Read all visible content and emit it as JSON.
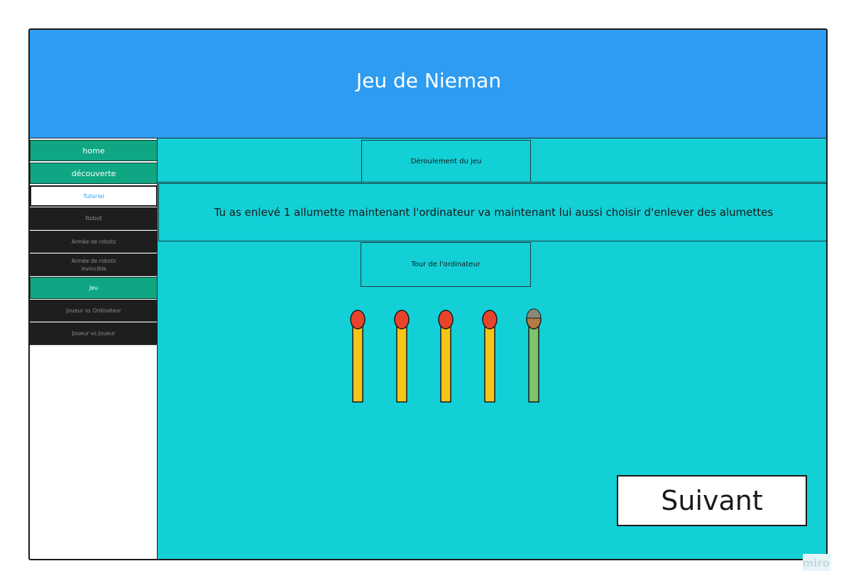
{
  "app": {
    "title": "Jeu de Nieman"
  },
  "sidebar": {
    "items": [
      {
        "label": "home"
      },
      {
        "label": "découverte"
      },
      {
        "label": "Tutoriel"
      },
      {
        "label": "Robot"
      },
      {
        "label": "Armée de robots"
      },
      {
        "label_line1": "Armée de robots",
        "label_line2": "invincible"
      },
      {
        "label": "Jeu"
      },
      {
        "label": "Joueur vs Ordinateur"
      },
      {
        "label": "Joueur vs Joueur"
      }
    ]
  },
  "main": {
    "section_label": "Déroulement du jeu",
    "message": "Tu as enlevé 1 allumette maintenant l'ordinateur va maintenant lui aussi choisir d'enlever des alumettes",
    "turn_label": "Tour de l'ordinateur",
    "matches": {
      "remaining": 4,
      "removed": 1,
      "colors": {
        "stick": "#f5c518",
        "head": "#e8442b",
        "removed_stick": "#7dc46b",
        "removed_head": "#b57a45"
      }
    },
    "next_button": "Suivant"
  },
  "watermark": "miro",
  "colors": {
    "header": "#2e9cf0",
    "main_bg": "#13cfd6",
    "nav_green": "#0fa783",
    "nav_dark": "#1e1e1e"
  }
}
